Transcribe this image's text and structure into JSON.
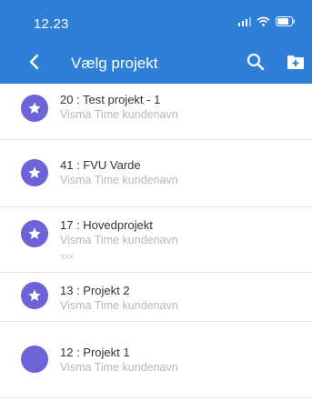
{
  "status_bar": {
    "time": "12.23"
  },
  "header": {
    "title": "Vælg projekt"
  },
  "projects": [
    {
      "name": "20 : Test projekt - 1",
      "customer": "Visma Time kundenavn",
      "extra": "",
      "favorite": true
    },
    {
      "name": "41 : FVU Varde",
      "customer": "Visma Time kundenavn",
      "extra": "",
      "favorite": true
    },
    {
      "name": "17 : Hovedprojekt",
      "customer": "Visma Time kundenavn",
      "extra": "xxx",
      "favorite": true
    },
    {
      "name": "13 : Projekt 2",
      "customer": "Visma Time kundenavn",
      "extra": "",
      "favorite": true
    },
    {
      "name": "12 : Projekt 1",
      "customer": "Visma Time kundenavn",
      "extra": "",
      "favorite": false
    }
  ],
  "colors": {
    "header": "#2f7fd8",
    "avatar": "#6c63d8"
  }
}
